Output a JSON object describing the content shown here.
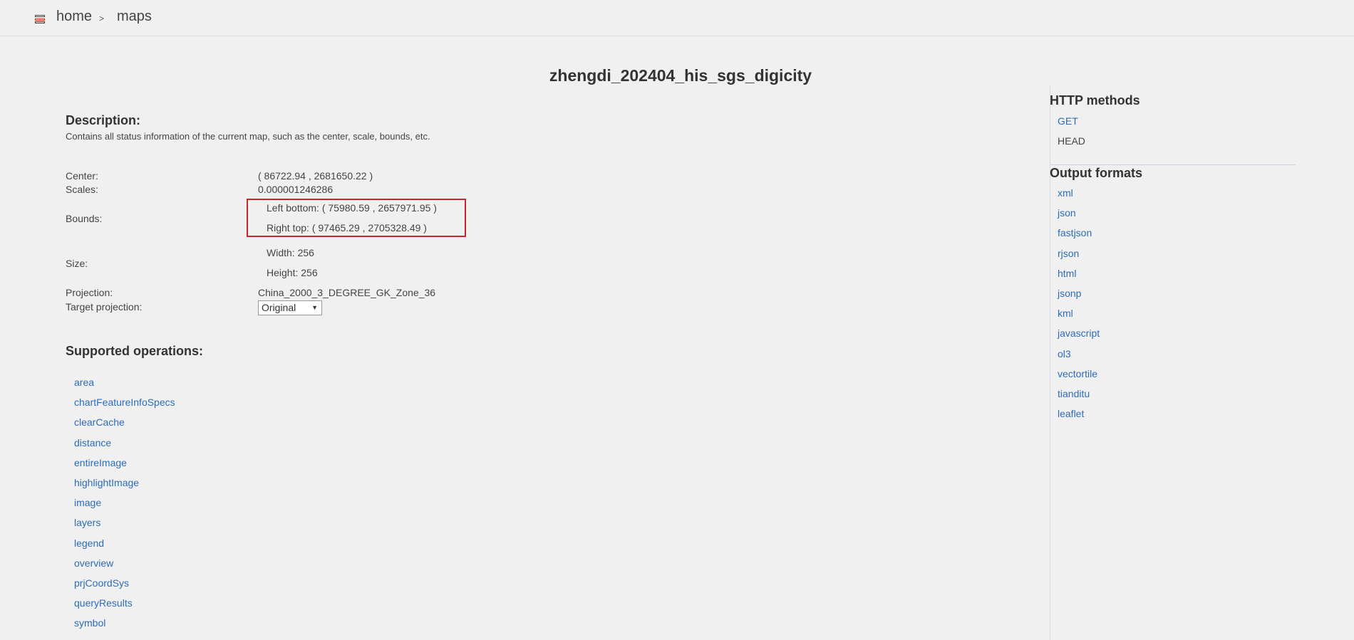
{
  "header": {
    "breadcrumb_home": "home",
    "breadcrumb_separator": ">",
    "breadcrumb_maps": "maps"
  },
  "title": "zhengdi_202404_his_sgs_digicity",
  "description": {
    "heading": "Description:",
    "text": "Contains all status information of the current map, such as the center, scale, bounds, etc."
  },
  "properties": {
    "center_label": "Center:",
    "center_value": "( 86722.94 , 2681650.22 )",
    "scales_label": "Scales:",
    "scales_value": "0.000001246286",
    "bounds_label": "Bounds:",
    "bounds_left_bottom": "Left bottom: ( 75980.59 , 2657971.95 )",
    "bounds_right_top": "Right top: ( 97465.29 , 2705328.49 )",
    "size_label": "Size:",
    "size_width": "Width: 256",
    "size_height": "Height: 256",
    "projection_label": "Projection:",
    "projection_value": "China_2000_3_DEGREE_GK_Zone_36",
    "target_projection_label": "Target projection:",
    "target_projection_selected": "Original"
  },
  "operations": {
    "heading": "Supported operations:",
    "items": [
      "area",
      "chartFeatureInfoSpecs",
      "clearCache",
      "distance",
      "entireImage",
      "highlightImage",
      "image",
      "layers",
      "legend",
      "overview",
      "prjCoordSys",
      "queryResults",
      "symbol"
    ]
  },
  "sidebar": {
    "http_heading": "HTTP methods",
    "http_methods": [
      "GET",
      "HEAD"
    ],
    "formats_heading": "Output formats",
    "formats": [
      "xml",
      "json",
      "fastjson",
      "rjson",
      "html",
      "jsonp",
      "kml",
      "javascript",
      "ol3",
      "vectortile",
      "tianditu",
      "leaflet"
    ]
  },
  "colors": {
    "link": "#2d6cb5",
    "highlight_border": "#c0282d",
    "background": "#f0f0f0"
  }
}
